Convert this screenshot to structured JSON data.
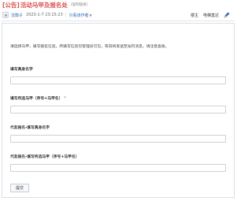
{
  "post": {
    "tag": "[公告]",
    "title": "活动马甲及报名处",
    "mark": "[复制链接]"
  },
  "meta": {
    "author": "沈衡子",
    "timestamp": "2023-1-7 23:15:23",
    "sep1": "|",
    "view_mode": "只看该作者",
    "caret": "▼",
    "floor_label": "楼主",
    "nav_label": "电梯直达"
  },
  "form": {
    "intro": "请选择马甲，填写报名信息。所填写信息仅管理员可见，有旧将发送至站内消息，请注意查收。",
    "fields": [
      {
        "label": "填写真身名字",
        "required": false,
        "value": "",
        "placeholder": ""
      },
      {
        "label": "填写所选马甲（序号+马甲名）",
        "required": true,
        "value": "",
        "placeholder": ""
      },
      {
        "label": "代友报名-填写真身名字",
        "required": false,
        "value": "",
        "placeholder": ""
      },
      {
        "label": "代友报名-填写所选马甲（序号+马甲名）",
        "required": false,
        "value": "",
        "placeholder": ""
      }
    ],
    "required_mark": "*",
    "submit_label": "提交"
  },
  "icons": {
    "edit": "pen-icon",
    "avatar": "avatar-icon"
  }
}
